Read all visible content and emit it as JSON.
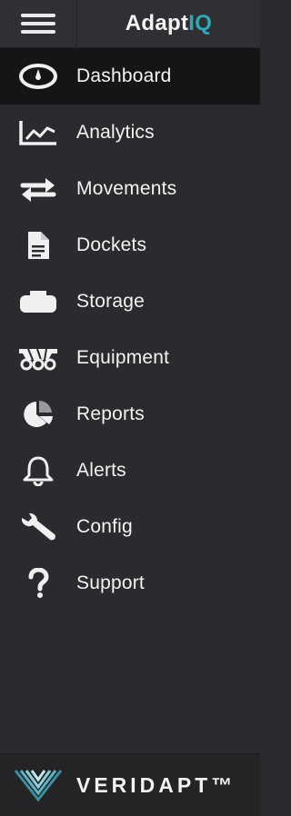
{
  "brand": {
    "name_main": "Adapt",
    "name_accent": "IQ",
    "accent_color": "#2fa7b8"
  },
  "topbar": {
    "menu_icon": "hamburger-menu-icon"
  },
  "nav": {
    "active": "Dashboard",
    "items": [
      {
        "label": "Dashboard",
        "icon": "dashboard-gauge-icon"
      },
      {
        "label": "Analytics",
        "icon": "line-chart-icon"
      },
      {
        "label": "Movements",
        "icon": "exchange-arrows-icon"
      },
      {
        "label": "Dockets",
        "icon": "document-icon"
      },
      {
        "label": "Storage",
        "icon": "tank-icon"
      },
      {
        "label": "Equipment",
        "icon": "truck-icon"
      },
      {
        "label": "Reports",
        "icon": "pie-chart-icon"
      },
      {
        "label": "Alerts",
        "icon": "bell-icon"
      },
      {
        "label": "Config",
        "icon": "wrench-icon"
      },
      {
        "label": "Support",
        "icon": "question-icon"
      }
    ]
  },
  "footer": {
    "brand": "VERIDAPT™",
    "logo_icon": "veridapt-chevron-logo"
  }
}
